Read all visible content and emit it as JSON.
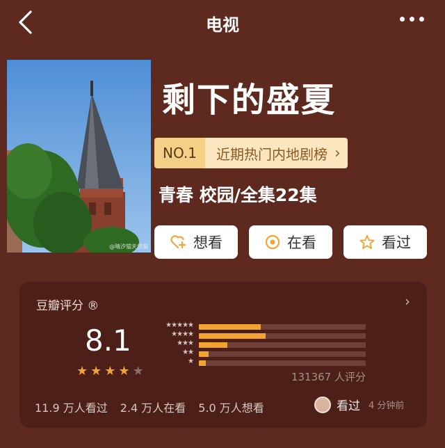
{
  "header": {
    "title": "电视",
    "back_icon": "chevron-left-icon",
    "more_icon": "more-dots-icon"
  },
  "show": {
    "title": "剩下的盛夏",
    "poster_credit": "@晴汐猫天然菊",
    "rank_no": "NO.1",
    "rank_list": "近期热门内地剧榜",
    "genre": "青春 校园/全集22集"
  },
  "actions": [
    {
      "label": "想看",
      "icon": "heart-plus-icon"
    },
    {
      "label": "在看",
      "icon": "target-icon"
    },
    {
      "label": "看过",
      "icon": "star-icon"
    }
  ],
  "rating": {
    "label": "豆瓣评分 ®",
    "score": "8.1",
    "stars_filled": 4,
    "stars_total": 5,
    "count": "131367 人评分",
    "distribution_percent": [
      37,
      40,
      17,
      6,
      4
    ],
    "colors": {
      "bar": "#f3a332",
      "track": "#6d3f36"
    }
  },
  "stats": {
    "watched": "11.9 万人看过",
    "watching": "2.4 万人在看",
    "want": "5.0 万人想看"
  },
  "friend": {
    "label": "看过",
    "time": "4 分钟前"
  }
}
